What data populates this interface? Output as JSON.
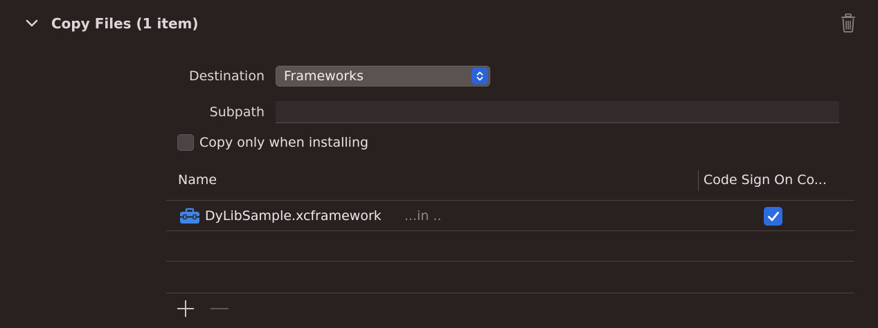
{
  "section": {
    "title": "Copy Files (1 item)"
  },
  "form": {
    "destination_label": "Destination",
    "destination_value": "Frameworks",
    "subpath_label": "Subpath",
    "subpath_value": "",
    "copy_only_label": "Copy only when installing",
    "copy_only_checked": false
  },
  "table": {
    "columns": [
      "Name",
      "Code Sign On Copy"
    ],
    "column_sign_display": "Code Sign On Co...",
    "rows": [
      {
        "name": "DyLibSample.xcframework",
        "location": "...in ..",
        "icon": "toolbox-icon",
        "code_sign": true
      }
    ]
  },
  "colors": {
    "background": "#292020",
    "accent": "#2d6ce0",
    "icon_blue": "#3f86e8"
  }
}
